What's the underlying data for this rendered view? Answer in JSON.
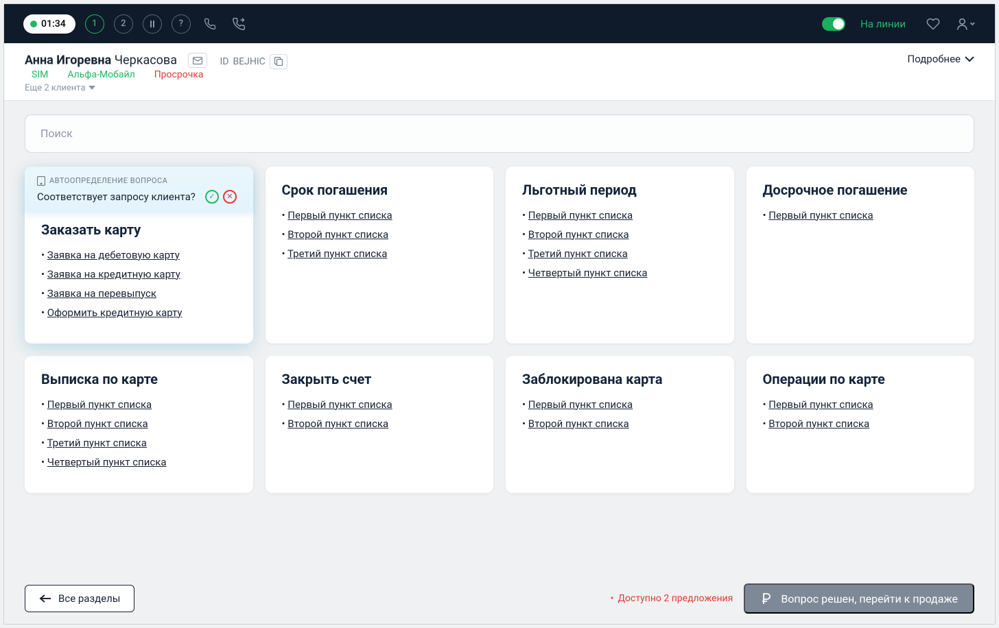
{
  "topbar": {
    "timer": "01:34",
    "indicators": [
      "1",
      "2"
    ],
    "online_label": "На линии"
  },
  "client": {
    "name_first": "Анна Игоревна",
    "name_last": "Черкасова",
    "id_prefix": "ID",
    "id": "BEJHIC",
    "more_clients": "Еще 2 клиента",
    "tags": [
      {
        "text": "SIM",
        "cls": "tag-green"
      },
      {
        "text": "Альфа-Мобайл",
        "cls": "tag-green"
      },
      {
        "text": "Просрочка",
        "cls": "tag-red"
      }
    ],
    "details": "Подробнее"
  },
  "search": {
    "placeholder": "Поиск"
  },
  "auto": {
    "label": "АВТООПРЕДЕЛЕНИЕ ВОПРОСА",
    "question": "Соответствует запросу клиента?"
  },
  "cards": [
    {
      "title": "Заказать карту",
      "featured": true,
      "items": [
        "Заявка на дебетовую карту",
        "Заявка на кредитную карту",
        "Заявка на перевыпуск",
        "Оформить кредитную карту"
      ]
    },
    {
      "title": "Срок погашения",
      "items": [
        "Первый пункт списка",
        "Второй пункт списка",
        "Третий пункт списка"
      ]
    },
    {
      "title": "Льготный период",
      "items": [
        "Первый пункт списка",
        "Второй пункт списка",
        "Третий пункт списка",
        "Четвертый пункт списка"
      ]
    },
    {
      "title": "Досрочное погашение",
      "items": [
        "Первый пункт списка"
      ]
    },
    {
      "title": "Выписка по карте",
      "items": [
        "Первый пункт списка",
        "Второй пункт списка",
        "Третий пункт списка",
        "Четвертый пункт списка"
      ]
    },
    {
      "title": "Закрыть счет",
      "items": [
        "Первый пункт списка",
        "Второй пункт списка"
      ]
    },
    {
      "title": "Заблокирована карта",
      "items": [
        "Первый пункт списка",
        "Второй пункт списка"
      ]
    },
    {
      "title": "Операции по карте",
      "items": [
        "Первый пункт списка",
        "Второй пункт списка"
      ]
    }
  ],
  "footer": {
    "all_sections": "Все разделы",
    "offers": "Доступно 2 предложения",
    "cta": "Вопрос решен, перейти к продаже"
  }
}
